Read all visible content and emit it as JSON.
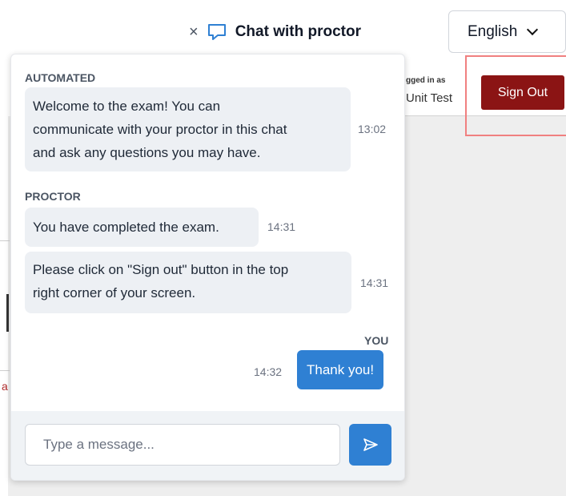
{
  "header": {
    "chat_title": "Chat with proctor",
    "close_glyph": "×",
    "chat_icon": "speech-bubble-icon",
    "language": "English"
  },
  "account": {
    "logged_in_label": "gged in as",
    "user_name": "Unit Test",
    "sign_out_label": "Sign Out"
  },
  "chat": {
    "groups": [
      {
        "sender": "AUTOMATED",
        "messages": [
          {
            "lines": [
              "Welcome to the exam! You can",
              "communicate with your proctor in this chat",
              "and ask any questions you may have."
            ],
            "time": "13:02"
          }
        ]
      },
      {
        "sender": "PROCTOR",
        "messages": [
          {
            "lines": [
              "You have completed the exam."
            ],
            "time": "14:31"
          },
          {
            "lines": [
              "Please click on \"Sign out\" button in the top",
              "right corner of your screen."
            ],
            "time": "14:31"
          }
        ]
      },
      {
        "sender": "YOU",
        "messages": [
          {
            "lines": [
              "Thank you!"
            ],
            "time": "14:32"
          }
        ]
      }
    ],
    "composer": {
      "placeholder": "Type a message...",
      "send_icon": "send-arrow-icon"
    }
  },
  "colors": {
    "accent": "#2f80d3",
    "sign_out_bg": "#8b1414",
    "highlight_border": "#f08080",
    "bubble_bg": "#edf0f4"
  }
}
